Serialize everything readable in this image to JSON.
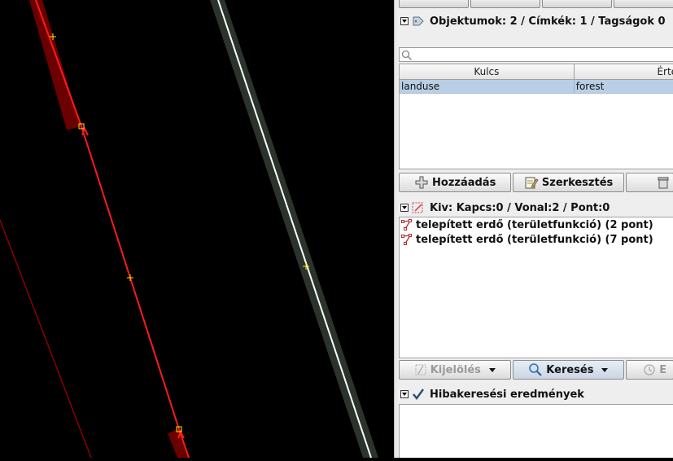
{
  "tags_panel": {
    "title": "Objektumok: 2 / Címkék: 1 / Tagságok 0",
    "search": {
      "value": "",
      "placeholder": ""
    },
    "columns": [
      "Kulcs",
      "Érték"
    ],
    "rows": [
      {
        "key": "landuse",
        "value": "forest"
      }
    ],
    "buttons": {
      "add": "Hozzáadás",
      "edit": "Szerkesztés"
    }
  },
  "selection_panel": {
    "title": "Kiv: Kapcs:0 / Vonal:2 / Pont:0",
    "items": [
      "telepített erdő (területfunkció) (2 pont)",
      "telepített erdő (területfunkció) (7 pont)"
    ],
    "buttons": {
      "select": "Kijelölés",
      "search": "Keresés",
      "history_partial": "E"
    }
  },
  "validation_panel": {
    "title": "Hibakeresési eredmények"
  },
  "colors": {
    "selected_way": "#ff1a1a",
    "unselected_way": "#8b0000",
    "highlight_road": "#2a332c",
    "road_center": "#ffffff",
    "node_marker": "#ffe600",
    "selected_row": "#b8cfe5"
  },
  "icons": [
    "tag-icon",
    "search-icon",
    "plus-icon",
    "edit-icon",
    "trash-icon",
    "selection-icon",
    "way-icon",
    "select-icon",
    "magnifier-icon",
    "history-icon",
    "check-icon"
  ]
}
